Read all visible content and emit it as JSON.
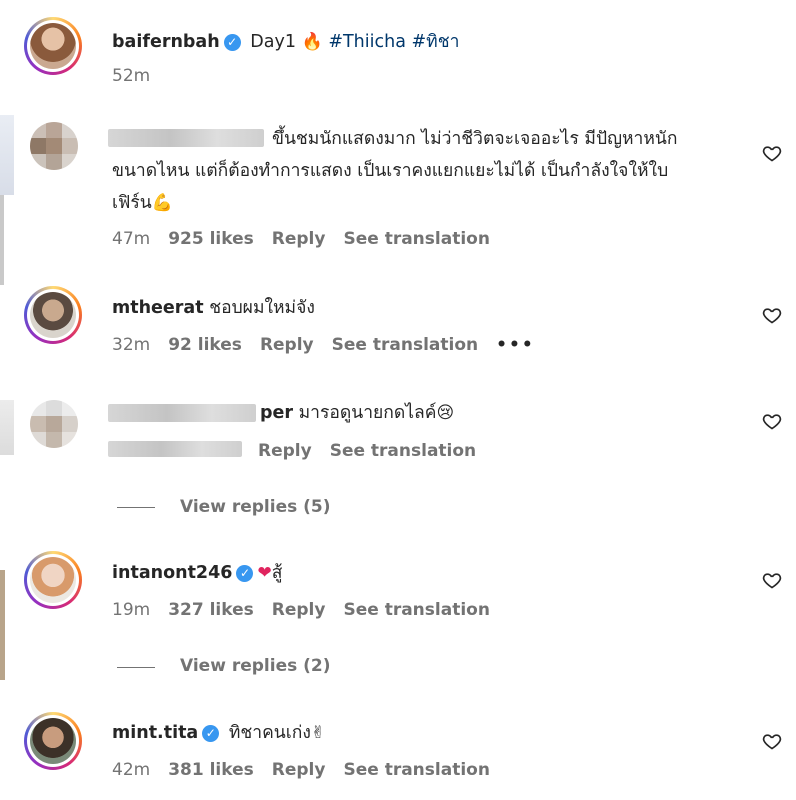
{
  "post": {
    "username": "baifernbah",
    "caption": "Day1",
    "caption_emoji": "🔥",
    "hashtags": [
      "#Thiicha",
      "#ทิชา"
    ],
    "time": "52m"
  },
  "comments": [
    {
      "username": "",
      "text_line1": "ขึ้นชมนักแสดงมาก ไม่ว่าชีวิตจะเจออะไร มีปัญหาหนัก",
      "text_line2": "ขนาดไหน แต่ก็ต้องทำการแสดง เป็นเราคงแยกแยะไม่ได้ เป็นกำลังใจให้ใบ",
      "text_line3": "เฟิร์น",
      "emoji": "💪",
      "time": "47m",
      "likes": "925 likes",
      "reply": "Reply",
      "translate": "See translation"
    },
    {
      "username": "mtheerat",
      "text": "ชอบผมใหม่จัง",
      "time": "32m",
      "likes": "92 likes",
      "reply": "Reply",
      "translate": "See translation",
      "more": "•••"
    },
    {
      "username_tail": "per",
      "text": "มารอดูนายกดไลค์",
      "emoji": "😢",
      "reply": "Reply",
      "translate": "See translation",
      "view_replies": "View replies (5)"
    },
    {
      "username": "intanont246",
      "text": "สู้",
      "emoji": "❤",
      "time": "19m",
      "likes": "327 likes",
      "reply": "Reply",
      "translate": "See translation",
      "view_replies": "View replies (2)"
    },
    {
      "username": "mint.tita",
      "text": "ทิชาคนเก่ง",
      "emoji": "✌",
      "time": "42m",
      "likes": "381 likes",
      "reply": "Reply",
      "translate": "See translation"
    }
  ],
  "icons": {
    "verified": "verified-badge-icon",
    "like": "heart-icon"
  },
  "colors": {
    "verified": "#3897f0",
    "hashtag": "#00376b",
    "meta": "#737373",
    "text": "#262626"
  }
}
